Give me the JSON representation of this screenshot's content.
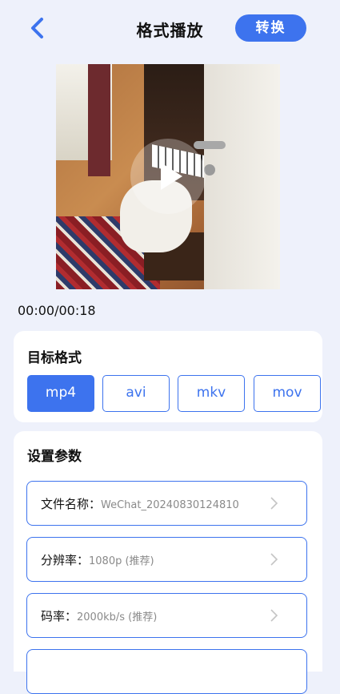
{
  "header": {
    "title": "格式播放",
    "convert_label": "转换"
  },
  "player": {
    "time": "00:00/00:18"
  },
  "target_format": {
    "title": "目标格式",
    "options": [
      "mp4",
      "avi",
      "mkv",
      "mov"
    ],
    "selected": "mp4"
  },
  "params": {
    "title": "设置参数",
    "rows": [
      {
        "label": "文件名称：",
        "value": "WeChat_20240830124810"
      },
      {
        "label": "分辨率：",
        "value": "1080p (推荐)"
      },
      {
        "label": "码率：",
        "value": "2000kb/s (推荐)"
      }
    ]
  },
  "colors": {
    "accent": "#3d73ee",
    "background": "#eef1fb"
  }
}
